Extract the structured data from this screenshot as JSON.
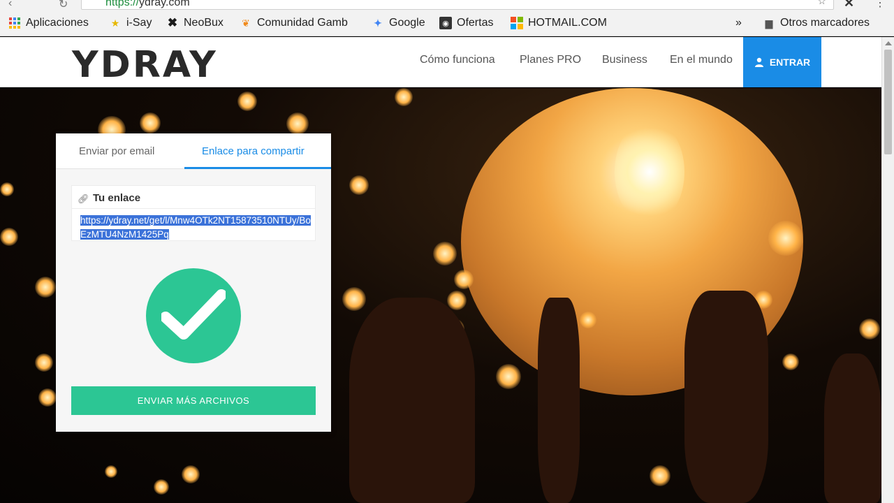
{
  "browser": {
    "url_protocol": "https://",
    "url_host": "ydray.com",
    "bookmarks": [
      {
        "label": "Aplicaciones",
        "icon": "apps-grid-icon"
      },
      {
        "label": "i-Say",
        "icon": "star-icon"
      },
      {
        "label": "NeoBux",
        "icon": "neobux-icon"
      },
      {
        "label": "Comunidad Gamb",
        "icon": "flame-icon"
      },
      {
        "label": "Google",
        "icon": "google-icon"
      },
      {
        "label": "Ofertas",
        "icon": "ofertas-icon"
      },
      {
        "label": "HOTMAIL.COM",
        "icon": "windows-icon"
      }
    ],
    "overflow": "»",
    "other_bookmarks": "Otros marcadores"
  },
  "site": {
    "logo": "YDRAY",
    "nav": [
      "Cómo funciona",
      "Planes PRO",
      "Business",
      "En el mundo"
    ],
    "login": "ENTRAR"
  },
  "card": {
    "tabs": [
      {
        "label": "Enviar por email",
        "active": false
      },
      {
        "label": "Enlace para compartir",
        "active": true
      }
    ],
    "link_label": "Tu enlace",
    "link_value": "https://ydray.net/get/l/Mnw4OTk2NT15873510NTUy/BoEzMTU4NzM1425Pq",
    "send_more": "ENVIAR MÁS ARCHIVOS"
  },
  "colors": {
    "accent": "#1a8ce6",
    "success": "#2cc694",
    "selection": "#3b72d9"
  }
}
